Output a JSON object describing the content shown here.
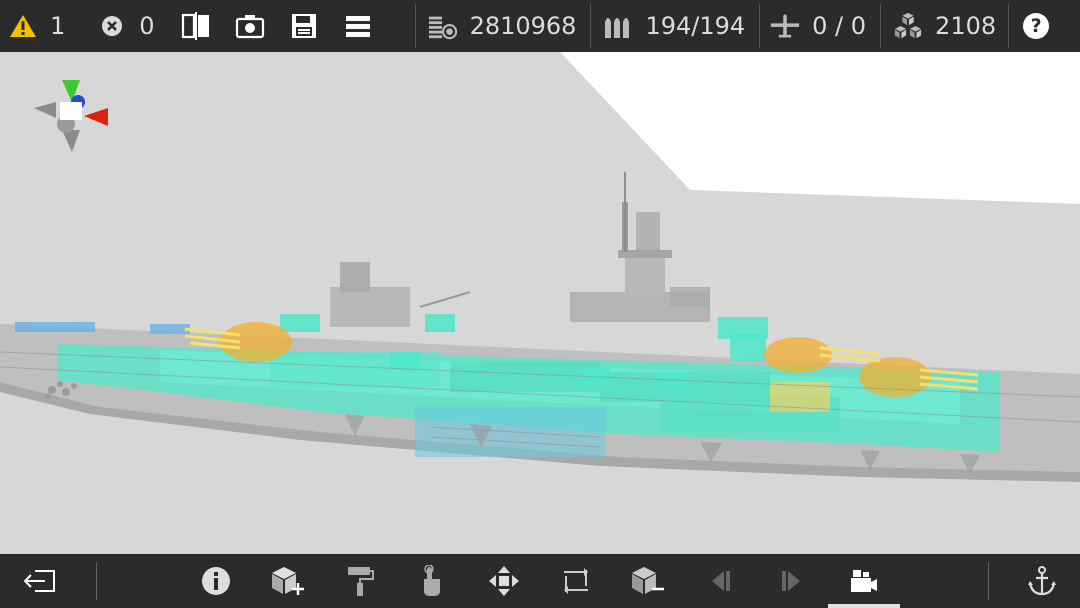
{
  "topbar": {
    "warnings": "1",
    "errors": "0",
    "cost": "2810968",
    "ammo": "194/194",
    "aircraft": "0 / 0",
    "blocks": "2108",
    "help_label": "?"
  },
  "colors": {
    "bar_bg": "#2b2b2b",
    "warning": "#f2c200",
    "armor": "#4de8c8",
    "turret": "#f0b030",
    "ground": "#d6d6d6",
    "sky": "#ffffff"
  }
}
